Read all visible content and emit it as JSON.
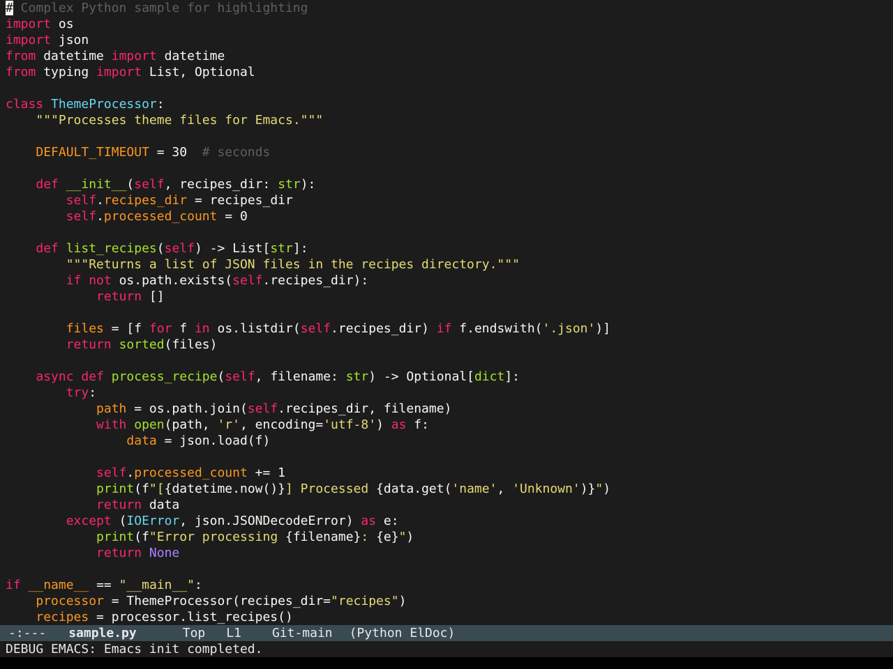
{
  "editor": {
    "lines": [
      [
        {
          "t": "#",
          "c": "cursor"
        },
        {
          "t": " Complex Python sample for highlighting",
          "c": "cmt"
        }
      ],
      [
        {
          "t": "import",
          "c": "kw"
        },
        {
          "t": " os",
          "c": "plain"
        }
      ],
      [
        {
          "t": "import",
          "c": "kw"
        },
        {
          "t": " json",
          "c": "plain"
        }
      ],
      [
        {
          "t": "from",
          "c": "kw"
        },
        {
          "t": " datetime ",
          "c": "plain"
        },
        {
          "t": "import",
          "c": "kw"
        },
        {
          "t": " datetime",
          "c": "plain"
        }
      ],
      [
        {
          "t": "from",
          "c": "kw"
        },
        {
          "t": " typing ",
          "c": "plain"
        },
        {
          "t": "import",
          "c": "kw"
        },
        {
          "t": " List, Optional",
          "c": "plain"
        }
      ],
      [],
      [
        {
          "t": "class",
          "c": "kw"
        },
        {
          "t": " ",
          "c": "plain"
        },
        {
          "t": "ThemeProcessor",
          "c": "cls"
        },
        {
          "t": ":",
          "c": "plain"
        }
      ],
      [
        {
          "t": "    ",
          "c": "plain"
        },
        {
          "t": "\"\"\"Processes theme files for Emacs.\"\"\"",
          "c": "str"
        }
      ],
      [],
      [
        {
          "t": "    ",
          "c": "plain"
        },
        {
          "t": "DEFAULT_TIMEOUT",
          "c": "var"
        },
        {
          "t": " = 30  ",
          "c": "plain"
        },
        {
          "t": "# seconds",
          "c": "cmt"
        }
      ],
      [],
      [
        {
          "t": "    ",
          "c": "plain"
        },
        {
          "t": "def",
          "c": "kw"
        },
        {
          "t": " ",
          "c": "plain"
        },
        {
          "t": "__init__",
          "c": "fn"
        },
        {
          "t": "(",
          "c": "plain"
        },
        {
          "t": "self",
          "c": "kw"
        },
        {
          "t": ", recipes_dir: ",
          "c": "plain"
        },
        {
          "t": "str",
          "c": "fn"
        },
        {
          "t": "):",
          "c": "plain"
        }
      ],
      [
        {
          "t": "        ",
          "c": "plain"
        },
        {
          "t": "self",
          "c": "kw"
        },
        {
          "t": ".",
          "c": "plain"
        },
        {
          "t": "recipes_dir",
          "c": "var"
        },
        {
          "t": " = recipes_dir",
          "c": "plain"
        }
      ],
      [
        {
          "t": "        ",
          "c": "plain"
        },
        {
          "t": "self",
          "c": "kw"
        },
        {
          "t": ".",
          "c": "plain"
        },
        {
          "t": "processed_count",
          "c": "var"
        },
        {
          "t": " = 0",
          "c": "plain"
        }
      ],
      [],
      [
        {
          "t": "    ",
          "c": "plain"
        },
        {
          "t": "def",
          "c": "kw"
        },
        {
          "t": " ",
          "c": "plain"
        },
        {
          "t": "list_recipes",
          "c": "fn"
        },
        {
          "t": "(",
          "c": "plain"
        },
        {
          "t": "self",
          "c": "kw"
        },
        {
          "t": ") -> List[",
          "c": "plain"
        },
        {
          "t": "str",
          "c": "fn"
        },
        {
          "t": "]:",
          "c": "plain"
        }
      ],
      [
        {
          "t": "        ",
          "c": "plain"
        },
        {
          "t": "\"\"\"Returns a list of JSON files in the recipes directory.\"\"\"",
          "c": "str"
        }
      ],
      [
        {
          "t": "        ",
          "c": "plain"
        },
        {
          "t": "if",
          "c": "kw"
        },
        {
          "t": " ",
          "c": "plain"
        },
        {
          "t": "not",
          "c": "kw"
        },
        {
          "t": " os.path.exists(",
          "c": "plain"
        },
        {
          "t": "self",
          "c": "kw"
        },
        {
          "t": ".recipes_dir):",
          "c": "plain"
        }
      ],
      [
        {
          "t": "            ",
          "c": "plain"
        },
        {
          "t": "return",
          "c": "kw"
        },
        {
          "t": " []",
          "c": "plain"
        }
      ],
      [],
      [
        {
          "t": "        ",
          "c": "plain"
        },
        {
          "t": "files",
          "c": "var"
        },
        {
          "t": " = [f ",
          "c": "plain"
        },
        {
          "t": "for",
          "c": "kw"
        },
        {
          "t": " f ",
          "c": "plain"
        },
        {
          "t": "in",
          "c": "kw"
        },
        {
          "t": " os.listdir(",
          "c": "plain"
        },
        {
          "t": "self",
          "c": "kw"
        },
        {
          "t": ".recipes_dir) ",
          "c": "plain"
        },
        {
          "t": "if",
          "c": "kw"
        },
        {
          "t": " f.endswith(",
          "c": "plain"
        },
        {
          "t": "'.json'",
          "c": "str"
        },
        {
          "t": ")]",
          "c": "plain"
        }
      ],
      [
        {
          "t": "        ",
          "c": "plain"
        },
        {
          "t": "return",
          "c": "kw"
        },
        {
          "t": " ",
          "c": "plain"
        },
        {
          "t": "sorted",
          "c": "fn"
        },
        {
          "t": "(files)",
          "c": "plain"
        }
      ],
      [],
      [
        {
          "t": "    ",
          "c": "plain"
        },
        {
          "t": "async",
          "c": "kw"
        },
        {
          "t": " ",
          "c": "plain"
        },
        {
          "t": "def",
          "c": "kw"
        },
        {
          "t": " ",
          "c": "plain"
        },
        {
          "t": "process_recipe",
          "c": "fn"
        },
        {
          "t": "(",
          "c": "plain"
        },
        {
          "t": "self",
          "c": "kw"
        },
        {
          "t": ", filename: ",
          "c": "plain"
        },
        {
          "t": "str",
          "c": "fn"
        },
        {
          "t": ") -> Optional[",
          "c": "plain"
        },
        {
          "t": "dict",
          "c": "fn"
        },
        {
          "t": "]:",
          "c": "plain"
        }
      ],
      [
        {
          "t": "        ",
          "c": "plain"
        },
        {
          "t": "try",
          "c": "kw"
        },
        {
          "t": ":",
          "c": "plain"
        }
      ],
      [
        {
          "t": "            ",
          "c": "plain"
        },
        {
          "t": "path",
          "c": "var"
        },
        {
          "t": " = os.path.join(",
          "c": "plain"
        },
        {
          "t": "self",
          "c": "kw"
        },
        {
          "t": ".recipes_dir, filename)",
          "c": "plain"
        }
      ],
      [
        {
          "t": "            ",
          "c": "plain"
        },
        {
          "t": "with",
          "c": "kw"
        },
        {
          "t": " ",
          "c": "plain"
        },
        {
          "t": "open",
          "c": "fn"
        },
        {
          "t": "(path, ",
          "c": "plain"
        },
        {
          "t": "'r'",
          "c": "str"
        },
        {
          "t": ", encoding=",
          "c": "plain"
        },
        {
          "t": "'utf-8'",
          "c": "str"
        },
        {
          "t": ") ",
          "c": "plain"
        },
        {
          "t": "as",
          "c": "kw"
        },
        {
          "t": " f:",
          "c": "plain"
        }
      ],
      [
        {
          "t": "                ",
          "c": "plain"
        },
        {
          "t": "data",
          "c": "var"
        },
        {
          "t": " = json.load(f)",
          "c": "plain"
        }
      ],
      [],
      [
        {
          "t": "            ",
          "c": "plain"
        },
        {
          "t": "self",
          "c": "kw"
        },
        {
          "t": ".",
          "c": "plain"
        },
        {
          "t": "processed_count",
          "c": "var"
        },
        {
          "t": " += 1",
          "c": "plain"
        }
      ],
      [
        {
          "t": "            ",
          "c": "plain"
        },
        {
          "t": "print",
          "c": "fn"
        },
        {
          "t": "(f",
          "c": "plain"
        },
        {
          "t": "\"[",
          "c": "str"
        },
        {
          "t": "{datetime.now()}",
          "c": "plain"
        },
        {
          "t": "] Processed ",
          "c": "str"
        },
        {
          "t": "{data.get(",
          "c": "plain"
        },
        {
          "t": "'name'",
          "c": "str"
        },
        {
          "t": ", ",
          "c": "plain"
        },
        {
          "t": "'Unknown'",
          "c": "str"
        },
        {
          "t": ")}",
          "c": "plain"
        },
        {
          "t": "\"",
          "c": "str"
        },
        {
          "t": ")",
          "c": "plain"
        }
      ],
      [
        {
          "t": "            ",
          "c": "plain"
        },
        {
          "t": "return",
          "c": "kw"
        },
        {
          "t": " data",
          "c": "plain"
        }
      ],
      [
        {
          "t": "        ",
          "c": "plain"
        },
        {
          "t": "except",
          "c": "kw"
        },
        {
          "t": " (",
          "c": "plain"
        },
        {
          "t": "IOError",
          "c": "cls"
        },
        {
          "t": ", json.JSONDecodeError) ",
          "c": "plain"
        },
        {
          "t": "as",
          "c": "kw"
        },
        {
          "t": " e:",
          "c": "plain"
        }
      ],
      [
        {
          "t": "            ",
          "c": "plain"
        },
        {
          "t": "print",
          "c": "fn"
        },
        {
          "t": "(f",
          "c": "plain"
        },
        {
          "t": "\"Error processing ",
          "c": "str"
        },
        {
          "t": "{filename}",
          "c": "plain"
        },
        {
          "t": ": ",
          "c": "str"
        },
        {
          "t": "{e}",
          "c": "plain"
        },
        {
          "t": "\"",
          "c": "str"
        },
        {
          "t": ")",
          "c": "plain"
        }
      ],
      [
        {
          "t": "            ",
          "c": "plain"
        },
        {
          "t": "return",
          "c": "kw"
        },
        {
          "t": " ",
          "c": "plain"
        },
        {
          "t": "None",
          "c": "const"
        }
      ],
      [],
      [
        {
          "t": "if",
          "c": "kw"
        },
        {
          "t": " ",
          "c": "plain"
        },
        {
          "t": "__name__",
          "c": "var"
        },
        {
          "t": " == ",
          "c": "plain"
        },
        {
          "t": "\"__main__\"",
          "c": "str"
        },
        {
          "t": ":",
          "c": "plain"
        }
      ],
      [
        {
          "t": "    ",
          "c": "plain"
        },
        {
          "t": "processor",
          "c": "var"
        },
        {
          "t": " = ThemeProcessor(recipes_dir=",
          "c": "plain"
        },
        {
          "t": "\"recipes\"",
          "c": "str"
        },
        {
          "t": ")",
          "c": "plain"
        }
      ],
      [
        {
          "t": "    ",
          "c": "plain"
        },
        {
          "t": "recipes",
          "c": "var"
        },
        {
          "t": " = processor.list_recipes()",
          "c": "plain"
        }
      ]
    ]
  },
  "mode_line": {
    "status": "-:---",
    "buffer_name": "sample.py",
    "position": "Top",
    "line": "L1",
    "vc": "Git-main",
    "modes": "(Python ElDoc)"
  },
  "echo_area": {
    "message": "DEBUG EMACS: Emacs init completed."
  },
  "colors": {
    "background": "#1c1c1c",
    "foreground": "#f8f8f2",
    "comment": "#5f5f5f",
    "keyword": "#f92672",
    "class_name": "#66d9ef",
    "string": "#e6db74",
    "variable": "#fd971f",
    "function": "#a6e22e",
    "constant": "#ae81ff",
    "mode_line_bg": "#3a4a52"
  }
}
